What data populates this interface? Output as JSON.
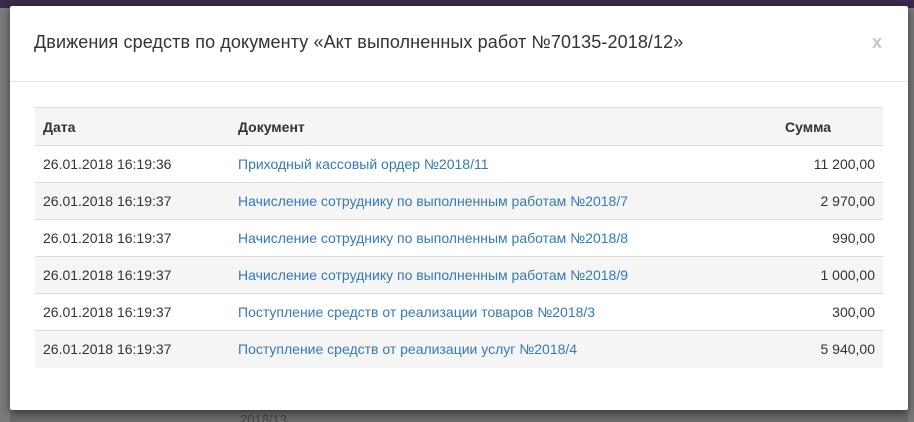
{
  "modal": {
    "title": "Движения средств по документу «Акт выполненных работ №70135-2018/12»",
    "close_label": "x"
  },
  "table": {
    "headers": {
      "date": "Дата",
      "document": "Документ",
      "sum": "Сумма"
    },
    "rows": [
      {
        "date": "26.01.2018 16:19:36",
        "document": "Приходный кассовый ордер №2018/11",
        "sum": "11 200,00"
      },
      {
        "date": "26.01.2018 16:19:37",
        "document": "Начисление сотруднику по выполненным работам №2018/7",
        "sum": "2 970,00"
      },
      {
        "date": "26.01.2018 16:19:37",
        "document": "Начисление сотруднику по выполненным работам №2018/8",
        "sum": "990,00"
      },
      {
        "date": "26.01.2018 16:19:37",
        "document": "Начисление сотруднику по выполненным работам №2018/9",
        "sum": "1 000,00"
      },
      {
        "date": "26.01.2018 16:19:37",
        "document": "Поступление средств от реализации товаров №2018/3",
        "sum": "300,00"
      },
      {
        "date": "26.01.2018 16:19:37",
        "document": "Поступление средств от реализации услуг №2018/4",
        "sum": "5 940,00"
      }
    ]
  },
  "background": {
    "bottom_text": "2018/13"
  },
  "colors": {
    "link": "#337ab7",
    "stripe": "#f5f5f5",
    "overlay": "#6b6b6b"
  }
}
